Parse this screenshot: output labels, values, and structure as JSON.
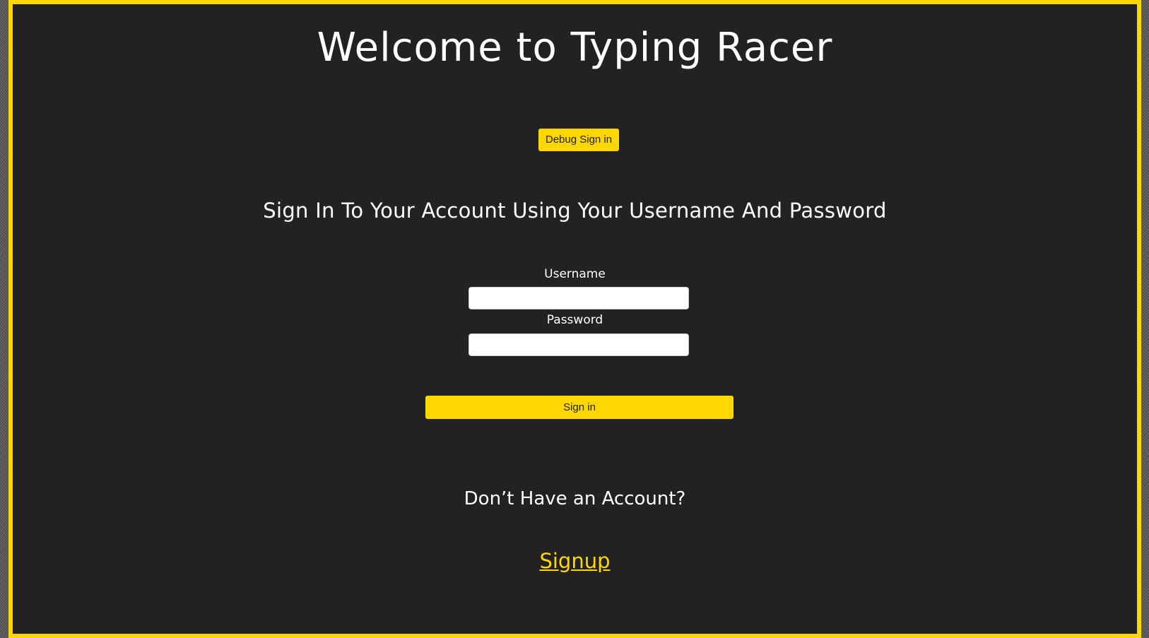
{
  "colors": {
    "accent": "#ffd700",
    "background": "#232223",
    "text": "#ffffff"
  },
  "header": {
    "title": "Welcome to Typing Racer"
  },
  "debug": {
    "button_label": "Debug Sign in"
  },
  "signin": {
    "heading": "Sign In To Your Account Using Your Username And Password",
    "username_label": "Username",
    "username_value": "",
    "password_label": "Password",
    "password_value": "",
    "submit_label": "Sign in"
  },
  "signup": {
    "prompt": "Don’t Have an Account?",
    "link_label": "Signup"
  }
}
